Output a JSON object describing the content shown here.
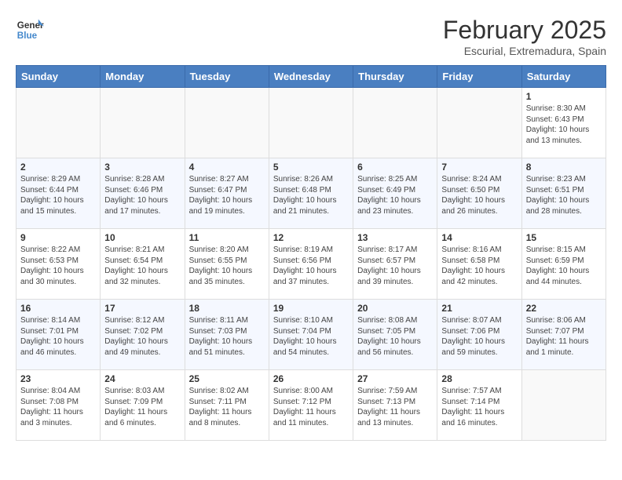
{
  "header": {
    "logo_general": "General",
    "logo_blue": "Blue",
    "title": "February 2025",
    "location": "Escurial, Extremadura, Spain"
  },
  "days_of_week": [
    "Sunday",
    "Monday",
    "Tuesday",
    "Wednesday",
    "Thursday",
    "Friday",
    "Saturday"
  ],
  "weeks": [
    [
      {
        "day": "",
        "info": ""
      },
      {
        "day": "",
        "info": ""
      },
      {
        "day": "",
        "info": ""
      },
      {
        "day": "",
        "info": ""
      },
      {
        "day": "",
        "info": ""
      },
      {
        "day": "",
        "info": ""
      },
      {
        "day": "1",
        "info": "Sunrise: 8:30 AM\nSunset: 6:43 PM\nDaylight: 10 hours\nand 13 minutes."
      }
    ],
    [
      {
        "day": "2",
        "info": "Sunrise: 8:29 AM\nSunset: 6:44 PM\nDaylight: 10 hours\nand 15 minutes."
      },
      {
        "day": "3",
        "info": "Sunrise: 8:28 AM\nSunset: 6:46 PM\nDaylight: 10 hours\nand 17 minutes."
      },
      {
        "day": "4",
        "info": "Sunrise: 8:27 AM\nSunset: 6:47 PM\nDaylight: 10 hours\nand 19 minutes."
      },
      {
        "day": "5",
        "info": "Sunrise: 8:26 AM\nSunset: 6:48 PM\nDaylight: 10 hours\nand 21 minutes."
      },
      {
        "day": "6",
        "info": "Sunrise: 8:25 AM\nSunset: 6:49 PM\nDaylight: 10 hours\nand 23 minutes."
      },
      {
        "day": "7",
        "info": "Sunrise: 8:24 AM\nSunset: 6:50 PM\nDaylight: 10 hours\nand 26 minutes."
      },
      {
        "day": "8",
        "info": "Sunrise: 8:23 AM\nSunset: 6:51 PM\nDaylight: 10 hours\nand 28 minutes."
      }
    ],
    [
      {
        "day": "9",
        "info": "Sunrise: 8:22 AM\nSunset: 6:53 PM\nDaylight: 10 hours\nand 30 minutes."
      },
      {
        "day": "10",
        "info": "Sunrise: 8:21 AM\nSunset: 6:54 PM\nDaylight: 10 hours\nand 32 minutes."
      },
      {
        "day": "11",
        "info": "Sunrise: 8:20 AM\nSunset: 6:55 PM\nDaylight: 10 hours\nand 35 minutes."
      },
      {
        "day": "12",
        "info": "Sunrise: 8:19 AM\nSunset: 6:56 PM\nDaylight: 10 hours\nand 37 minutes."
      },
      {
        "day": "13",
        "info": "Sunrise: 8:17 AM\nSunset: 6:57 PM\nDaylight: 10 hours\nand 39 minutes."
      },
      {
        "day": "14",
        "info": "Sunrise: 8:16 AM\nSunset: 6:58 PM\nDaylight: 10 hours\nand 42 minutes."
      },
      {
        "day": "15",
        "info": "Sunrise: 8:15 AM\nSunset: 6:59 PM\nDaylight: 10 hours\nand 44 minutes."
      }
    ],
    [
      {
        "day": "16",
        "info": "Sunrise: 8:14 AM\nSunset: 7:01 PM\nDaylight: 10 hours\nand 46 minutes."
      },
      {
        "day": "17",
        "info": "Sunrise: 8:12 AM\nSunset: 7:02 PM\nDaylight: 10 hours\nand 49 minutes."
      },
      {
        "day": "18",
        "info": "Sunrise: 8:11 AM\nSunset: 7:03 PM\nDaylight: 10 hours\nand 51 minutes."
      },
      {
        "day": "19",
        "info": "Sunrise: 8:10 AM\nSunset: 7:04 PM\nDaylight: 10 hours\nand 54 minutes."
      },
      {
        "day": "20",
        "info": "Sunrise: 8:08 AM\nSunset: 7:05 PM\nDaylight: 10 hours\nand 56 minutes."
      },
      {
        "day": "21",
        "info": "Sunrise: 8:07 AM\nSunset: 7:06 PM\nDaylight: 10 hours\nand 59 minutes."
      },
      {
        "day": "22",
        "info": "Sunrise: 8:06 AM\nSunset: 7:07 PM\nDaylight: 11 hours\nand 1 minute."
      }
    ],
    [
      {
        "day": "23",
        "info": "Sunrise: 8:04 AM\nSunset: 7:08 PM\nDaylight: 11 hours\nand 3 minutes."
      },
      {
        "day": "24",
        "info": "Sunrise: 8:03 AM\nSunset: 7:09 PM\nDaylight: 11 hours\nand 6 minutes."
      },
      {
        "day": "25",
        "info": "Sunrise: 8:02 AM\nSunset: 7:11 PM\nDaylight: 11 hours\nand 8 minutes."
      },
      {
        "day": "26",
        "info": "Sunrise: 8:00 AM\nSunset: 7:12 PM\nDaylight: 11 hours\nand 11 minutes."
      },
      {
        "day": "27",
        "info": "Sunrise: 7:59 AM\nSunset: 7:13 PM\nDaylight: 11 hours\nand 13 minutes."
      },
      {
        "day": "28",
        "info": "Sunrise: 7:57 AM\nSunset: 7:14 PM\nDaylight: 11 hours\nand 16 minutes."
      },
      {
        "day": "",
        "info": ""
      }
    ]
  ]
}
